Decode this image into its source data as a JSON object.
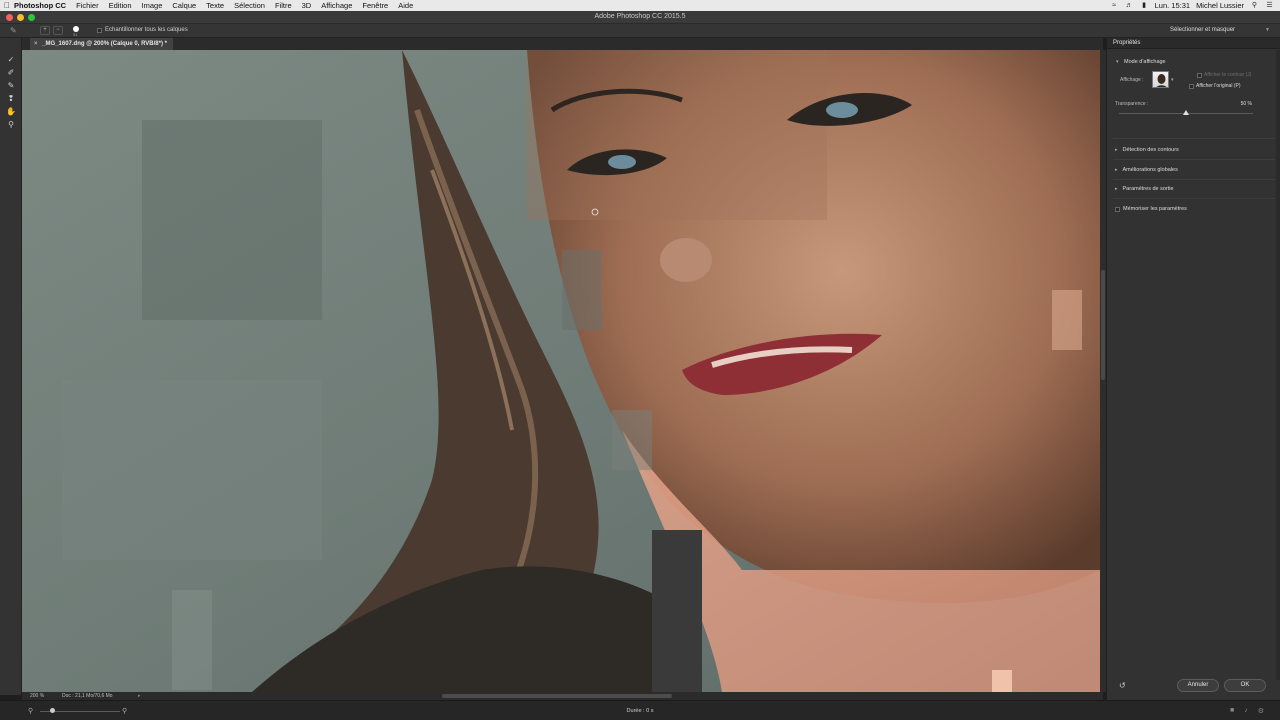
{
  "menubar": {
    "app_name": "Photoshop CC",
    "items": [
      "Fichier",
      "Edition",
      "Image",
      "Calque",
      "Texte",
      "Sélection",
      "Filtre",
      "3D",
      "Affichage",
      "Fenêtre",
      "Aide"
    ],
    "clock": "Lun. 15:31",
    "user": "Michel Lussier"
  },
  "window": {
    "title": "Adobe Photoshop CC 2015.5"
  },
  "options_bar": {
    "brush_size": "31",
    "sample_all_layers_label": "Echantillonner tous les calques",
    "select_mask_label": "Sélectionner et masquer"
  },
  "document": {
    "tab_label": "_MG_1607.dng @ 200% (Calque 0, RVB/8*) *",
    "zoom": "200 %",
    "doc_info": "Doc : 21,1 Mo/70,6 Mo"
  },
  "timeline": {
    "duration": "Durée : 0 s"
  },
  "panel": {
    "title": "Propriétés",
    "view_mode_title": "Mode d'affichage",
    "display_label": "Affichage :",
    "show_edge_label": "Afficher le contour (J)",
    "show_original_label": "Afficher l'original (P)",
    "transparency_label": "Transparence :",
    "transparency_value": "50 %",
    "transparency_fraction": 0.5,
    "sections": [
      "Détection des contours",
      "Améliorations globales",
      "Paramètres de sortie"
    ],
    "remember_label": "Mémoriser les paramètres",
    "cancel_label": "Annuler",
    "ok_label": "OK"
  }
}
